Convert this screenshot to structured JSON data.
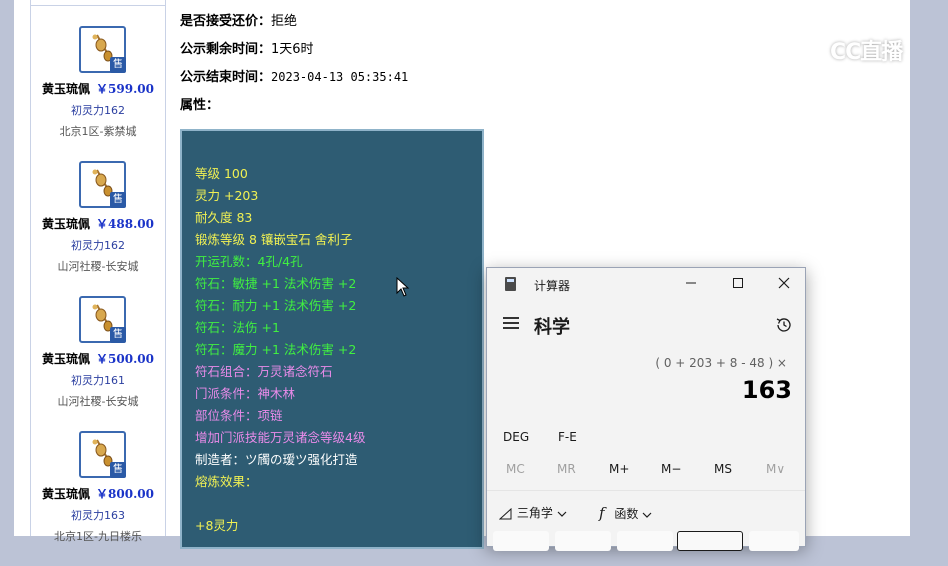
{
  "listings": [
    {
      "name": "黄玉琉佩",
      "price": "￥599.00",
      "spirit": "初灵力162",
      "server": "北京1区-紫禁城"
    },
    {
      "name": "黄玉琉佩",
      "price": "￥488.00",
      "spirit": "初灵力162",
      "server": "山河社稷-长安城"
    },
    {
      "name": "黄玉琉佩",
      "price": "￥500.00",
      "spirit": "初灵力161",
      "server": "山河社稷-长安城"
    },
    {
      "name": "黄玉琉佩",
      "price": "￥800.00",
      "spirit": "初灵力163",
      "server": "北京1区-九日楼乐"
    }
  ],
  "sell_tag": "售",
  "details": {
    "bargain_label": "是否接受还价：",
    "bargain_value": "拒绝",
    "remaining_label": "公示剩余时间：",
    "remaining_value": "1天6时",
    "end_label": "公示结束时间：",
    "end_value": "2023-04-13 05:35:41",
    "attr_label": "属性："
  },
  "attributes": [
    {
      "text": "等级 100",
      "color": "#f1f153"
    },
    {
      "text": "灵力 +203",
      "color": "#f1f153"
    },
    {
      "text": "耐久度 83",
      "color": "#f1f153"
    },
    {
      "text": "锻炼等级 8 镶嵌宝石 舍利子",
      "color": "#f1f153"
    },
    {
      "text": "开运孔数：4孔/4孔",
      "color": "#40f040"
    },
    {
      "text": "符石：敏捷 +1 法术伤害 +2",
      "color": "#40f040"
    },
    {
      "text": "符石：耐力 +1 法术伤害 +2",
      "color": "#40f040"
    },
    {
      "text": "符石：法伤 +1",
      "color": "#40f040"
    },
    {
      "text": "符石：魔力 +1 法术伤害 +2",
      "color": "#40f040"
    },
    {
      "text": "符石组合：万灵诸念符石",
      "color": "#e98be9"
    },
    {
      "text": "门派条件：神木林",
      "color": "#e98be9"
    },
    {
      "text": "部位条件：项链",
      "color": "#e98be9"
    },
    {
      "text": "增加门派技能万灵诸念等级4级",
      "color": "#e98be9"
    },
    {
      "text": "制造者：ツ斶の瑷ツ强化打造",
      "color": "#ffffff"
    },
    {
      "text": "熔炼效果：",
      "color": "#f1f153"
    },
    {
      "text": "",
      "color": "#f1f153"
    },
    {
      "text": "+8灵力",
      "color": "#f1f153"
    }
  ],
  "watermark": {
    "text": "CC直播"
  },
  "calculator": {
    "title": "计算器",
    "mode": "科学",
    "expression": "( 0 + 203 + 8 - 48 ) ×",
    "display": "163",
    "angle_mode": "DEG",
    "fe_label": "F-E",
    "memory": [
      "MC",
      "MR",
      "M+",
      "M−",
      "MS",
      "M∨"
    ],
    "trig_label": "三角学",
    "func_label": "函数"
  }
}
